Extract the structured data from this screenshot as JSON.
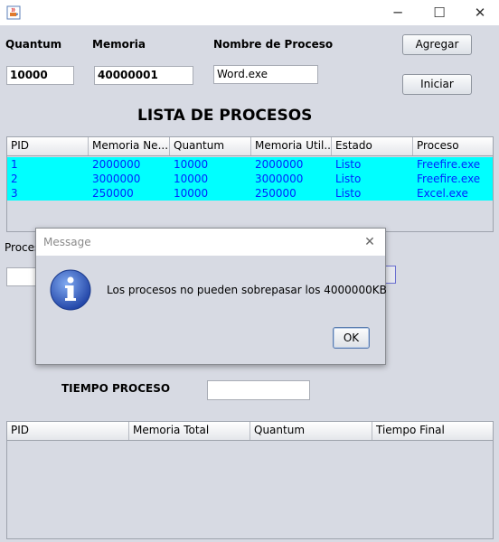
{
  "window": {
    "app_icon": "java-cup-icon",
    "controls": {
      "minimize": "─",
      "maximize": "☐",
      "close": "✕"
    }
  },
  "form": {
    "quantum_label": "Quantum",
    "quantum_value": "10000",
    "memoria_label": "Memoria",
    "memoria_value": "40000001",
    "nombre_label": "Nombre de Proceso",
    "nombre_value": "Word.exe",
    "agregar_button": "Agregar",
    "iniciar_button": "Iniciar"
  },
  "lista_title": "LISTA DE PROCESOS",
  "process_table": {
    "columns": [
      "PID",
      "Memoria Ne...",
      "Quantum",
      "Memoria Util...",
      "Estado",
      "Proceso"
    ],
    "rows": [
      [
        "1",
        "2000000",
        "10000",
        "2000000",
        "Listo",
        "Freefire.exe"
      ],
      [
        "2",
        "3000000",
        "10000",
        "3000000",
        "Listo",
        "Freefire.exe"
      ],
      [
        "3",
        "250000",
        "10000",
        "250000",
        "Listo",
        "Excel.exe"
      ]
    ],
    "row_color": "#00ffff",
    "text_color": "#0026ff"
  },
  "middle": {
    "proceso_label": "Proces",
    "tiempo_proceso_label": "TIEMPO PROCESO"
  },
  "final_table": {
    "columns": [
      "PID",
      "Memoria Total",
      "Quantum",
      "Tiempo Final"
    ]
  },
  "dialog": {
    "title": "Message",
    "close": "✕",
    "icon": "info-icon",
    "message": "Los procesos no pueden sobrepasar los 4000000KB",
    "ok_button": "OK"
  }
}
